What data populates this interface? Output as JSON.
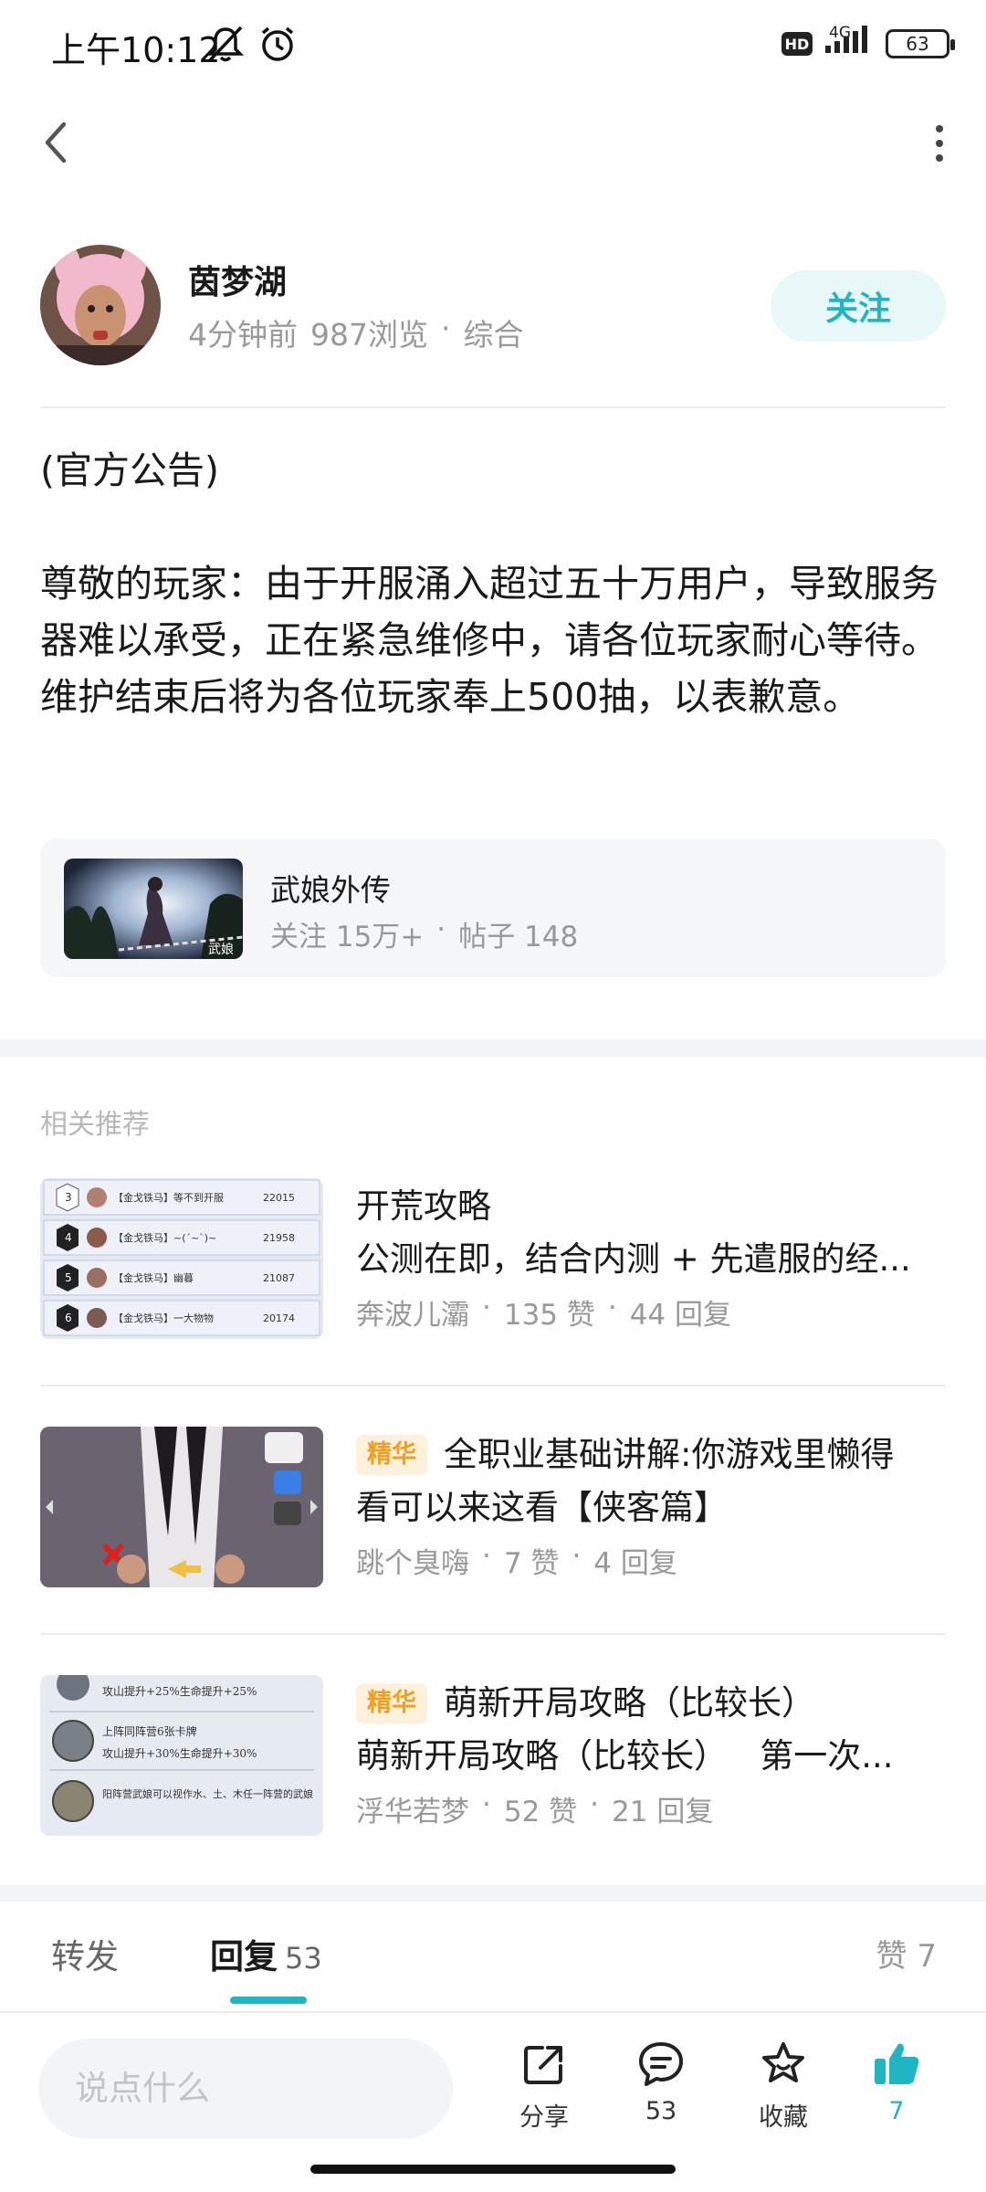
{
  "status_bar": {
    "time": "上午10:12",
    "network": "4G",
    "hd": "HD",
    "battery": "63"
  },
  "author": {
    "name": "茵梦湖",
    "time_ago": "4分钟前",
    "views": "987浏览",
    "separator": "·",
    "category": "综合",
    "follow_label": "关注"
  },
  "post": {
    "heading": "(官方公告)",
    "body": "尊敬的玩家：由于开服涌入超过五十万用户，导致服务器难以承受，正在紧急维修中，请各位玩家耐心等待。维护结束后将为各位玩家奉上500抽，以表歉意。"
  },
  "game_card": {
    "name": "武娘外传",
    "followers": "关注 15万+",
    "separator": "·",
    "posts": "帖子 148"
  },
  "related": {
    "title": "相关推荐",
    "items": [
      {
        "tag": "",
        "title_line1": "开荒攻略",
        "title_line2": "公测在即，结合内测 + 先遣服的经...",
        "author": "奔波儿灞",
        "likes": "135 赞",
        "replies": "44 回复",
        "thumb_rows": [
          {
            "rank": "3",
            "name": "【金戈铁马】等不到开服",
            "score": "22015"
          },
          {
            "rank": "4",
            "name": "【金戈铁马】~(ˊ~ˋ)~",
            "score": "21958"
          },
          {
            "rank": "5",
            "name": "【金戈铁马】幽暮",
            "score": "21087"
          },
          {
            "rank": "6",
            "name": "【金戈铁马】一大物物",
            "score": "20174"
          }
        ]
      },
      {
        "tag": "精华",
        "title_line1": "全职业基础讲解:你游戏里懒得",
        "title_line2": "看可以来这看【侠客篇】",
        "author": "跳个臭嗨",
        "likes": "7 赞",
        "replies": "4 回复"
      },
      {
        "tag": "精华",
        "title_line1": "萌新开局攻略（比较长）",
        "title_line2": "萌新开局攻略（比较长）   第一次...",
        "author": "浮华若梦",
        "likes": "52 赞",
        "replies": "21 回复",
        "thumb_rows": [
          {
            "text": "攻山提升+25%生命提升+25%"
          },
          {
            "text": "上阵同阵营6张卡牌"
          },
          {
            "text": "攻山提升+30%生命提升+30%"
          },
          {
            "text": "阳阵营武娘可以视作水、土、木任一阵营的武娘"
          }
        ]
      }
    ]
  },
  "tabs": {
    "forward": "转发",
    "reply": "回复",
    "reply_count": "53",
    "like": "赞 7"
  },
  "bottom_bar": {
    "input_placeholder": "说点什么",
    "share_label": "分享",
    "comment_count": "53",
    "favorite_label": "收藏",
    "like_count": "7"
  },
  "colors": {
    "accent": "#1fb5c2",
    "tag_bg": "#fdf1dc",
    "tag_text": "#f0a020",
    "muted": "#999999"
  }
}
